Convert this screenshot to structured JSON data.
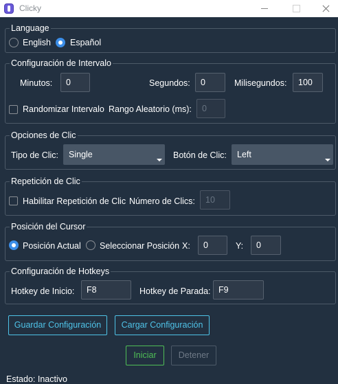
{
  "window": {
    "title": "Clicky"
  },
  "language": {
    "title": "Language",
    "options": [
      "English",
      "Español"
    ],
    "selected": "Español"
  },
  "interval": {
    "title": "Configuración de Intervalo",
    "minutes_label": "Minutos:",
    "minutes_value": "0",
    "seconds_label": "Segundos:",
    "seconds_value": "0",
    "ms_label": "Milisegundos:",
    "ms_value": "100",
    "randomize_label": "Randomizar Intervalo",
    "randomize_checked": false,
    "random_range_label": "Rango Aleatorio (ms):",
    "random_range_value": "0"
  },
  "click_options": {
    "title": "Opciones de Clic",
    "type_label": "Tipo de Clic:",
    "type_value": "Single",
    "button_label": "Botón de Clic:",
    "button_value": "Left"
  },
  "repeat": {
    "title": "Repetición de Clic",
    "enable_label": "Habilitar Repetición de Clic",
    "enable_checked": false,
    "count_label": "Número de Clics:",
    "count_value": "10"
  },
  "cursor": {
    "title": "Posición del Cursor",
    "current_label": "Posición Actual",
    "select_label": "Seleccionar Posición",
    "selected": "Posición Actual",
    "x_label": "X:",
    "x_value": "0",
    "y_label": "Y:",
    "y_value": "0"
  },
  "hotkeys": {
    "title": "Configuración de Hotkeys",
    "start_label": "Hotkey de Inicio:",
    "start_value": "F8",
    "stop_label": "Hotkey de Parada:",
    "stop_value": "F9"
  },
  "actions": {
    "save_label": "Guardar Configuración",
    "load_label": "Cargar Configuración",
    "start_label": "Iniciar",
    "stop_label": "Detener"
  },
  "status": {
    "text": "Estado: Inactivo"
  },
  "colors": {
    "background": "#223040",
    "accent": "#4fc3e8",
    "start": "#4fbf56",
    "radio_selected": "#3c8ee8"
  }
}
